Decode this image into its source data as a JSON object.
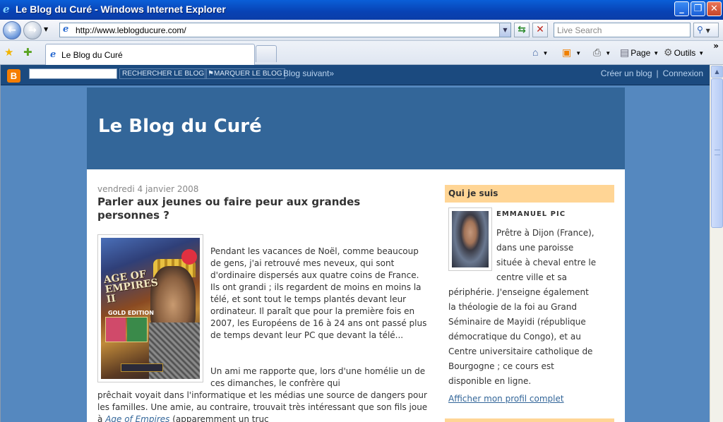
{
  "window": {
    "title": "Le Blog du Curé - Windows Internet Explorer",
    "buttons": {
      "minimize": "_",
      "restore": "❐",
      "close": "✕"
    }
  },
  "address_bar": {
    "url": "http://www.leblogducure.com/",
    "search_placeholder": "Live Search"
  },
  "tabs": [
    {
      "label": "Le Blog du Curé"
    }
  ],
  "toolbar": {
    "page_label": "Page",
    "tools_label": "Outils"
  },
  "blogger_navbar": {
    "search_button": "RECHERCHER LE BLOG",
    "flag_button": "MARQUER LE BLOG",
    "next_blog": "Blog suivant»",
    "create_blog": "Créer un blog",
    "separator": "|",
    "login": "Connexion"
  },
  "blog": {
    "title": "Le Blog du Curé"
  },
  "post": {
    "date": "vendredi 4 janvier 2008",
    "title": "Parler aux jeunes ou faire peur aux grandes personnes ?",
    "paragraph1": "Pendant les vacances de Noël, comme beaucoup de gens, j'ai retrouvé mes neveux, qui sont d'ordinaire dispersés aux quatre coins de France. Ils ont grandi ; ils regardent de moins en moins la télé, et sont tout le temps plantés devant leur ordinateur. Il paraît que pour la première fois en 2007, les Européens de 16 à 24 ans ont passé plus de temps devant leur PC que devant la télé...",
    "paragraph2_start": "Un ami me rapporte que, lors d'une homélie un de ces dimanches, le confrère qui",
    "paragraph2_rest": "prêchait voyait dans l'informatique et les médias une source de dangers pour les familles. Une amie, au contraire, trouvait très intéressant que son fils joue à",
    "game_name": "Age of Empires",
    "paragraph2_tail": "(apparemment un truc",
    "image_text": {
      "game_title": "AGE OF EMPIRES II",
      "edition": "GOLD EDITION"
    }
  },
  "sidebar": {
    "about_heading": "Qui je suis",
    "author_name": "EMMANUEL PIC",
    "bio": "Prêtre à Dijon (France), dans une paroisse située à cheval entre le centre ville et sa périphérie. J'enseigne également la théologie de la foi au Grand Séminaire de Mayidi (république démocratique du Congo), et au Centre universitaire catholique de Bourgogne ; ce cours est disponible en ligne.",
    "bio_lines": [
      "Prêtre à Dijon (France),",
      "dans une paroisse",
      "située à cheval entre le",
      "centre ville et sa",
      "périphérie. J'enseigne également",
      "la théologie de la foi au Grand",
      "Séminaire de Mayidi (république",
      "démocratique du Congo), et au",
      "Centre universitaire catholique de",
      "Bourgogne ; ce cours est",
      "disponible en ligne."
    ],
    "profile_link": "Afficher mon profil complet"
  },
  "colors": {
    "page_background": "#5588bf",
    "header_background": "#336699",
    "navbar_background": "#1b4a7f",
    "sidebar_heading": "#ffd595",
    "link": "#336699",
    "text": "#333333"
  },
  "icons": {
    "ie_logo": "internet-explorer-icon",
    "back": "back-arrow-icon",
    "forward": "forward-arrow-icon",
    "refresh": "refresh-icon",
    "stop": "stop-icon",
    "search": "search-icon",
    "favorites": "star-icon",
    "add_favorite": "add-favorite-icon",
    "home": "home-icon",
    "feeds": "rss-icon",
    "print": "print-icon",
    "page": "page-icon",
    "tools": "gear-icon",
    "blogger": "blogger-logo"
  }
}
